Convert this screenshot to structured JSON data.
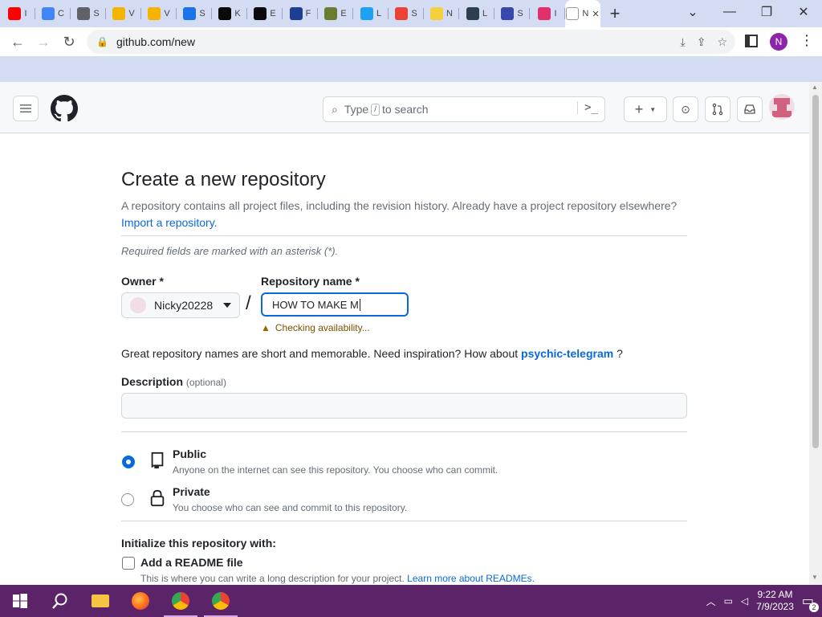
{
  "browser": {
    "tabs": [
      {
        "label": "I",
        "color": "#ff0000",
        "icon": "youtube-icon"
      },
      {
        "label": "C",
        "color": "#4285f4",
        "icon": "google-icon"
      },
      {
        "label": "S",
        "color": "#5f6368",
        "icon": "settings-icon"
      },
      {
        "label": "V",
        "color": "#f4b400",
        "icon": "folder-icon"
      },
      {
        "label": "V",
        "color": "#f4b400",
        "icon": "folder-icon"
      },
      {
        "label": "S",
        "color": "#1a73e8",
        "icon": "site-icon"
      },
      {
        "label": "K",
        "color": "#0a0a0a",
        "icon": "kim-icon"
      },
      {
        "label": "E",
        "color": "#0a0a0a",
        "icon": "game-icon"
      },
      {
        "label": "F",
        "color": "#1c3f94",
        "icon": "site-icon"
      },
      {
        "label": "E",
        "color": "#6b7c2e",
        "icon": "site-icon"
      },
      {
        "label": "L",
        "color": "#1da1f2",
        "icon": "twitter-icon"
      },
      {
        "label": "S",
        "color": "#ea4335",
        "icon": "gmail-icon"
      },
      {
        "label": "N",
        "color": "#f4d03f",
        "icon": "bulb-icon"
      },
      {
        "label": "L",
        "color": "#2c3e50",
        "icon": "site-icon"
      },
      {
        "label": "S",
        "color": "#3949ab",
        "icon": "sonic-icon"
      },
      {
        "label": "I",
        "color": "#e1306c",
        "icon": "instagram-icon"
      },
      {
        "label": "N",
        "color": "#ffffff",
        "icon": "github-icon",
        "active": true
      }
    ],
    "url": "github.com/new",
    "profile_initial": "N"
  },
  "header": {
    "search_prefix": "Type",
    "search_slash": "/",
    "search_suffix": "to search",
    "command_glyph": ">_",
    "plus_glyph": "+"
  },
  "page": {
    "title": "Create a new repository",
    "subtitle": "A repository contains all project files, including the revision history. Already have a project repository elsewhere?",
    "import_link": "Import a repository.",
    "required_note": "Required fields are marked with an asterisk (*).",
    "owner_label": "Owner *",
    "owner_value": "Nicky20228",
    "separator": "/",
    "repo_label": "Repository name *",
    "repo_value": "HOW TO MAKE M",
    "checking": "Checking availability...",
    "inspire_text": "Great repository names are short and memorable. Need inspiration? How about",
    "inspire_suggestion": "psychic-telegram",
    "inspire_end": "?",
    "description_label": "Description",
    "description_optional": "(optional)",
    "description_value": "",
    "public_title": "Public",
    "public_desc": "Anyone on the internet can see this repository. You choose who can commit.",
    "private_title": "Private",
    "private_desc": "You choose who can see and commit to this repository.",
    "visibility_selected": "Public",
    "init_title": "Initialize this repository with:",
    "readme_label": "Add a README file",
    "readme_desc": "This is where you can write a long description for your project.",
    "readme_link": "Learn more about READMEs."
  },
  "taskbar": {
    "time": "9:22 AM",
    "date": "7/9/2023",
    "notification_count": "2"
  }
}
